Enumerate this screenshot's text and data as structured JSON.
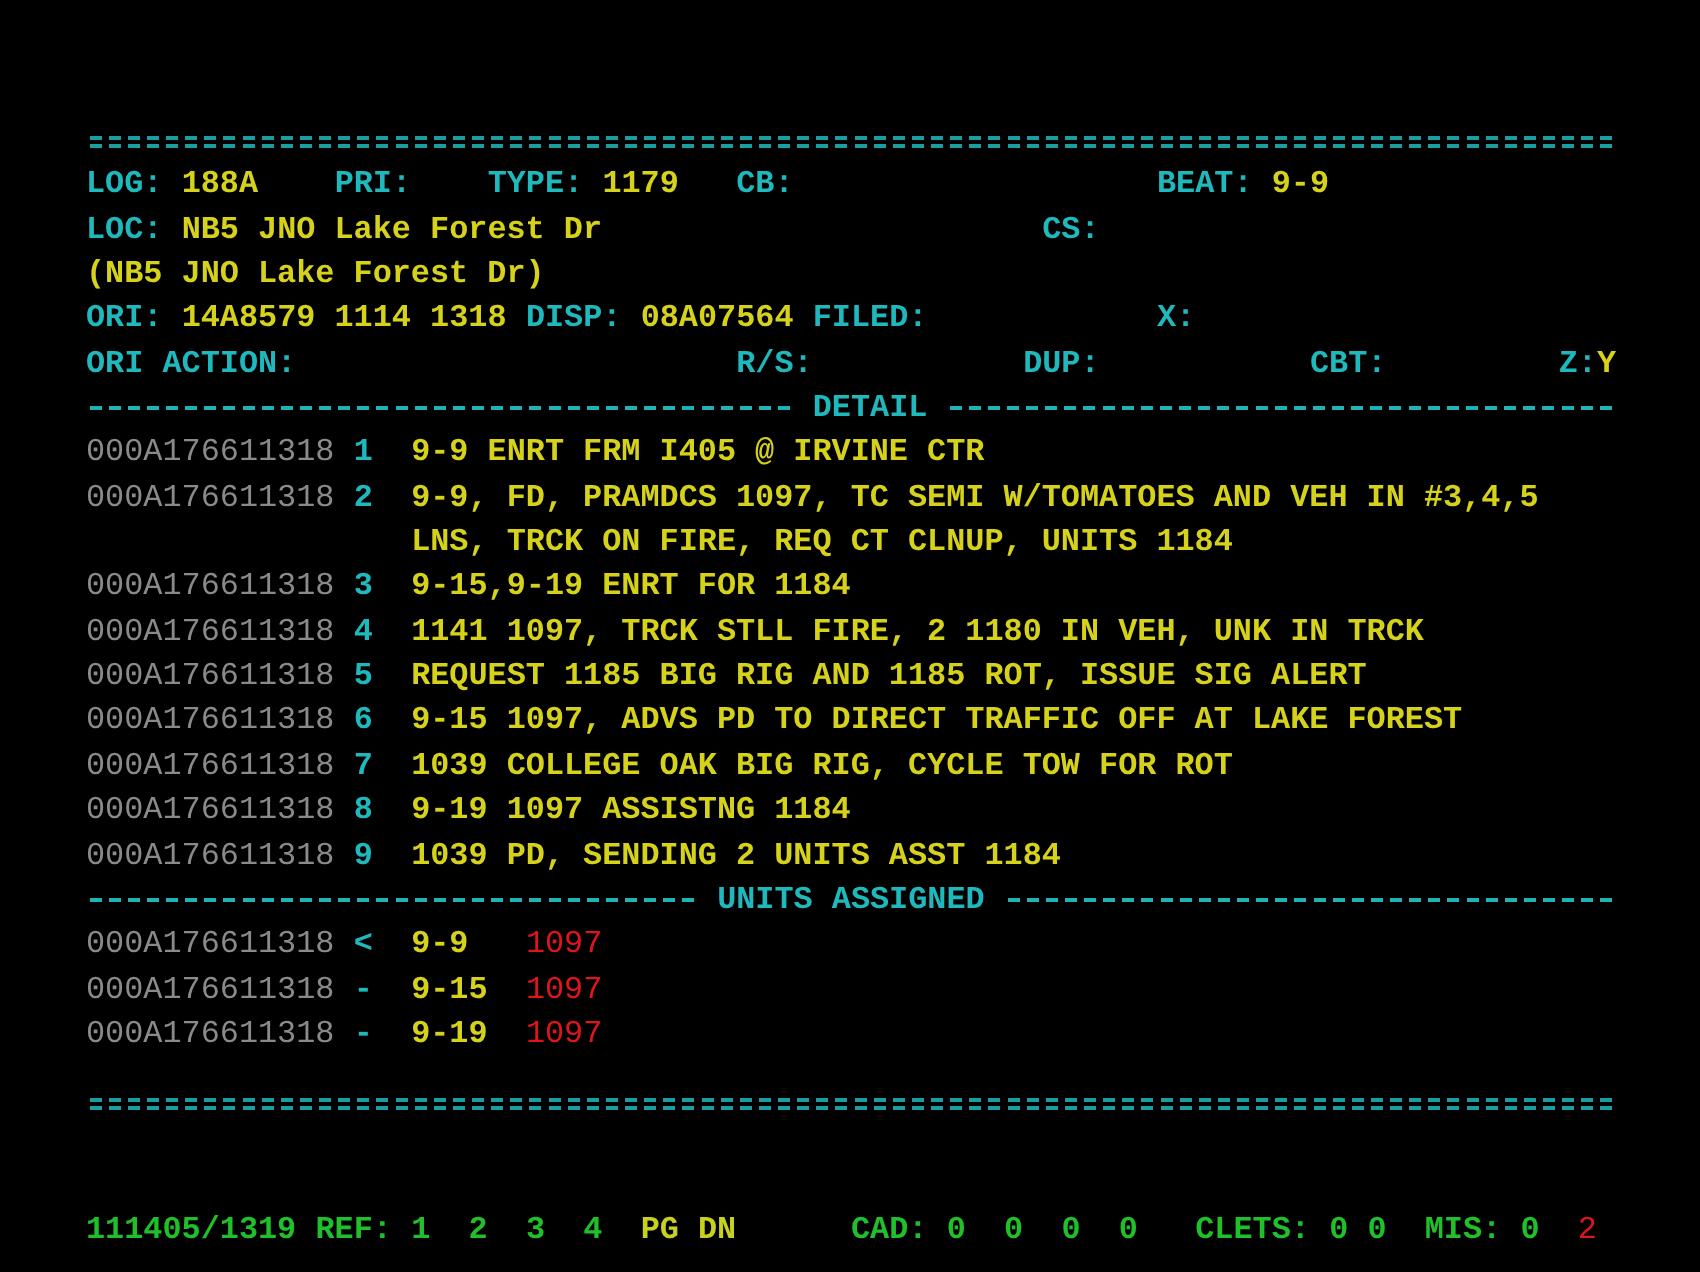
{
  "fields": [
    [
      {
        "label": "LOG:",
        "value": "188A"
      },
      {
        "label": "PRI:"
      },
      {
        "label": "TYPE:",
        "value": "1179"
      },
      {
        "label": "CB:"
      },
      {
        "label": "BEAT:",
        "value": "9-9"
      }
    ],
    [
      {
        "label": "LOC:",
        "value": "NB5 JNO Lake Forest Dr"
      },
      {
        "label": "CS:"
      }
    ],
    [
      {
        "value": "(NB5 JNO Lake Forest Dr)"
      }
    ],
    [
      {
        "label": "ORI:",
        "value": "14A8579 1114 1318"
      },
      {
        "label": "DISP:",
        "value": "08A07564"
      },
      {
        "label": "FILED:"
      },
      {
        "label": "X:"
      }
    ],
    [
      {
        "label": "ORI ACTION:"
      },
      {
        "label": "R/S:"
      },
      {
        "label": "DUP:"
      },
      {
        "label": "CBT:"
      },
      {
        "label": "Z:",
        "value": "Y"
      }
    ]
  ],
  "detail": {
    "title": "DETAIL",
    "entries": [
      {
        "id": "000A176611318",
        "num": "1",
        "lines": [
          "9-9 ENRT FRM I405 @ IRVINE CTR"
        ]
      },
      {
        "id": "000A176611318",
        "num": "2",
        "lines": [
          "9-9, FD, PRAMDCS 1097, TC SEMI W/TOMATOES AND VEH IN #3,4,5",
          "LNS, TRCK ON FIRE, REQ CT CLNUP, UNITS 1184"
        ]
      },
      {
        "id": "000A176611318",
        "num": "3",
        "lines": [
          "9-15,9-19 ENRT FOR 1184"
        ]
      },
      {
        "id": "000A176611318",
        "num": "4",
        "lines": [
          "1141 1097, TRCK STLL FIRE, 2 1180 IN VEH, UNK IN TRCK"
        ]
      },
      {
        "id": "000A176611318",
        "num": "5",
        "lines": [
          "REQUEST 1185 BIG RIG AND 1185 ROT, ISSUE SIG ALERT"
        ]
      },
      {
        "id": "000A176611318",
        "num": "6",
        "lines": [
          "9-15 1097, ADVS PD TO DIRECT TRAFFIC OFF AT LAKE FOREST"
        ]
      },
      {
        "id": "000A176611318",
        "num": "7",
        "lines": [
          "1039 COLLEGE OAK BIG RIG, CYCLE TOW FOR ROT"
        ]
      },
      {
        "id": "000A176611318",
        "num": "8",
        "lines": [
          "9-19 1097 ASSISTNG 1184"
        ]
      },
      {
        "id": "000A176611318",
        "num": "9",
        "lines": [
          "1039 PD, SENDING 2 UNITS ASST 1184"
        ]
      }
    ]
  },
  "units": {
    "title": "UNITS ASSIGNED",
    "rows": [
      {
        "id": "000A176611318",
        "marker": "<",
        "unit": "9-9",
        "status": "1097"
      },
      {
        "id": "000A176611318",
        "marker": "-",
        "unit": "9-15",
        "status": "1097"
      },
      {
        "id": "000A176611318",
        "marker": "-",
        "unit": "9-19",
        "status": "1097"
      }
    ]
  },
  "status_bar": {
    "time": "111405/1319",
    "ref_label": "REF:",
    "refs": [
      "1",
      "2",
      "3",
      "4"
    ],
    "page": "PG DN",
    "cad_label": "CAD:",
    "cad": [
      "0",
      "0",
      "0",
      "0"
    ],
    "clets_label": "CLETS:",
    "clets": [
      "0",
      "0"
    ],
    "mis_label": "MIS:",
    "mis": [
      {
        "text": "0",
        "alert": false
      },
      {
        "text": "2",
        "alert": true
      }
    ]
  }
}
